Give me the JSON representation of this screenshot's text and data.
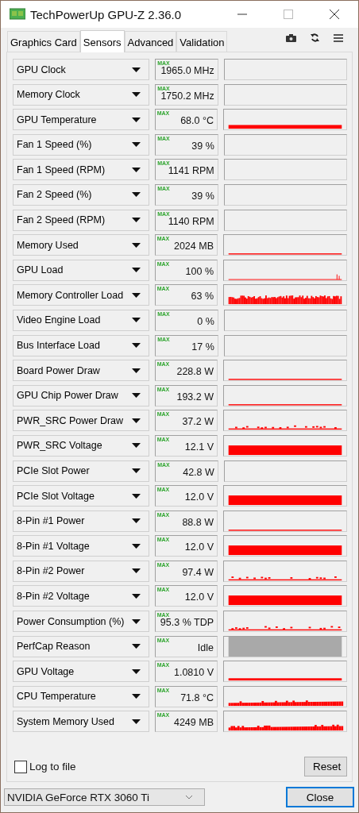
{
  "window": {
    "title": "TechPowerUp GPU-Z 2.36.0"
  },
  "tabs": [
    {
      "label": "Graphics Card",
      "selected": false
    },
    {
      "label": "Sensors",
      "selected": true
    },
    {
      "label": "Advanced",
      "selected": false
    },
    {
      "label": "Validation",
      "selected": false
    }
  ],
  "sensors": [
    {
      "name": "GPU Clock",
      "max_label": "MAX",
      "value": "1965.0 MHz",
      "kind": "none"
    },
    {
      "name": "Memory Clock",
      "max_label": "MAX",
      "value": "1750.2 MHz",
      "kind": "none"
    },
    {
      "name": "GPU Temperature",
      "max_label": "MAX",
      "value": "68.0 °C",
      "kind": "band"
    },
    {
      "name": "Fan 1 Speed (%)",
      "max_label": "MAX",
      "value": "39 %",
      "kind": "none"
    },
    {
      "name": "Fan 1 Speed (RPM)",
      "max_label": "MAX",
      "value": "1141 RPM",
      "kind": "none"
    },
    {
      "name": "Fan 2 Speed (%)",
      "max_label": "MAX",
      "value": "39 %",
      "kind": "none"
    },
    {
      "name": "Fan 2 Speed (RPM)",
      "max_label": "MAX",
      "value": "1140 RPM",
      "kind": "none"
    },
    {
      "name": "Memory Used",
      "max_label": "MAX",
      "value": "2024 MB",
      "kind": "line"
    },
    {
      "name": "GPU Load",
      "max_label": "MAX",
      "value": "100 %",
      "kind": "spike"
    },
    {
      "name": "Memory Controller Load",
      "max_label": "MAX",
      "value": "63 %",
      "kind": "noise"
    },
    {
      "name": "Video Engine Load",
      "max_label": "MAX",
      "value": "0 %",
      "kind": "none"
    },
    {
      "name": "Bus Interface Load",
      "max_label": "MAX",
      "value": "17 %",
      "kind": "none"
    },
    {
      "name": "Board Power Draw",
      "max_label": "MAX",
      "value": "228.8 W",
      "kind": "line"
    },
    {
      "name": "GPU Chip Power Draw",
      "max_label": "MAX",
      "value": "193.2 W",
      "kind": "line"
    },
    {
      "name": "PWR_SRC Power Draw",
      "max_label": "MAX",
      "value": "37.2 W",
      "kind": "sparse"
    },
    {
      "name": "PWR_SRC Voltage",
      "max_label": "MAX",
      "value": "12.1 V",
      "kind": "block"
    },
    {
      "name": "PCIe Slot Power",
      "max_label": "MAX",
      "value": "42.8 W",
      "kind": "none"
    },
    {
      "name": "PCIe Slot Voltage",
      "max_label": "MAX",
      "value": "12.0 V",
      "kind": "block"
    },
    {
      "name": "8-Pin #1 Power",
      "max_label": "MAX",
      "value": "88.8 W",
      "kind": "line"
    },
    {
      "name": "8-Pin #1 Voltage",
      "max_label": "MAX",
      "value": "12.0 V",
      "kind": "block"
    },
    {
      "name": "8-Pin #2 Power",
      "max_label": "MAX",
      "value": "97.4 W",
      "kind": "sparse"
    },
    {
      "name": "8-Pin #2 Voltage",
      "max_label": "MAX",
      "value": "12.0 V",
      "kind": "block"
    },
    {
      "name": "Power Consumption (%)",
      "max_label": "MAX",
      "value": "95.3 % TDP",
      "kind": "sparse"
    },
    {
      "name": "PerfCap Reason",
      "max_label": "MAX",
      "value": "Idle",
      "kind": "gray"
    },
    {
      "name": "GPU Voltage",
      "max_label": "MAX",
      "value": "1.0810 V",
      "kind": "thin"
    },
    {
      "name": "CPU Temperature",
      "max_label": "MAX",
      "value": "71.8 °C",
      "kind": "steps"
    },
    {
      "name": "System Memory Used",
      "max_label": "MAX",
      "value": "4249 MB",
      "kind": "steps"
    }
  ],
  "log_to_file": {
    "label": "Log to file",
    "checked": false
  },
  "reset_button": "Reset",
  "device_select": {
    "value": "NVIDIA GeForce RTX 3060 Ti"
  },
  "close_button": "Close"
}
